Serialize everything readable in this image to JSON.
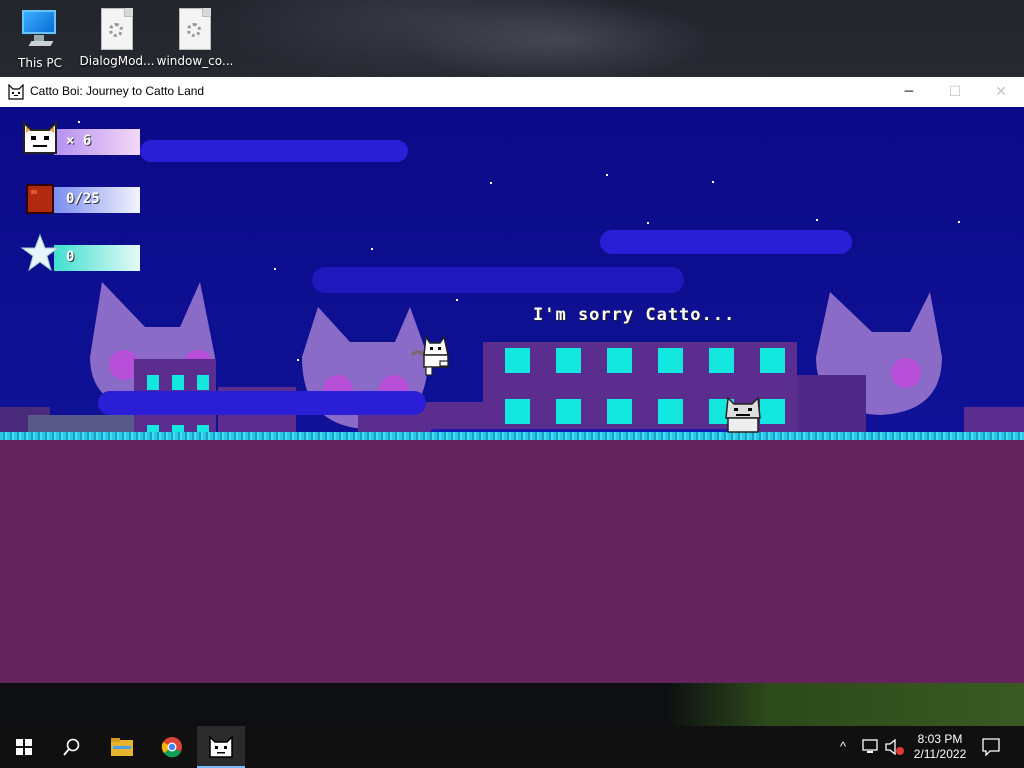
{
  "desktop": {
    "icons": [
      {
        "label": "This PC",
        "icon": "this-pc-icon"
      },
      {
        "label": "DialogMod...",
        "icon": "settings-file-icon"
      },
      {
        "label": "window_co...",
        "icon": "settings-file-icon"
      }
    ]
  },
  "window": {
    "title": "Catto Boi: Journey to Catto Land",
    "icon": "catto-app-icon",
    "controls": {
      "minimize": "─",
      "maximize": "☐",
      "close": "✕"
    }
  },
  "game": {
    "hud": {
      "lives": "× 6",
      "collectibles": "0/25",
      "stars": "0"
    },
    "dialog": "I'm sorry Catto..."
  },
  "taskbar": {
    "icons": [
      "windows-start-icon",
      "search-icon",
      "file-explorer-icon",
      "chrome-icon",
      "catto-app-icon"
    ],
    "tray": {
      "chevron": "^",
      "network": "network-icon",
      "volume": "volume-muted-icon"
    },
    "time": "8:03 PM",
    "date": "2/11/2022"
  },
  "colors": {
    "sky": "#0b0a88",
    "ground": "#63245e",
    "building": "#5b2d8e",
    "window_lights": "#12e8e0",
    "cat_silhouette": "#8a6cc8",
    "cloud": "#2a1fd6"
  }
}
